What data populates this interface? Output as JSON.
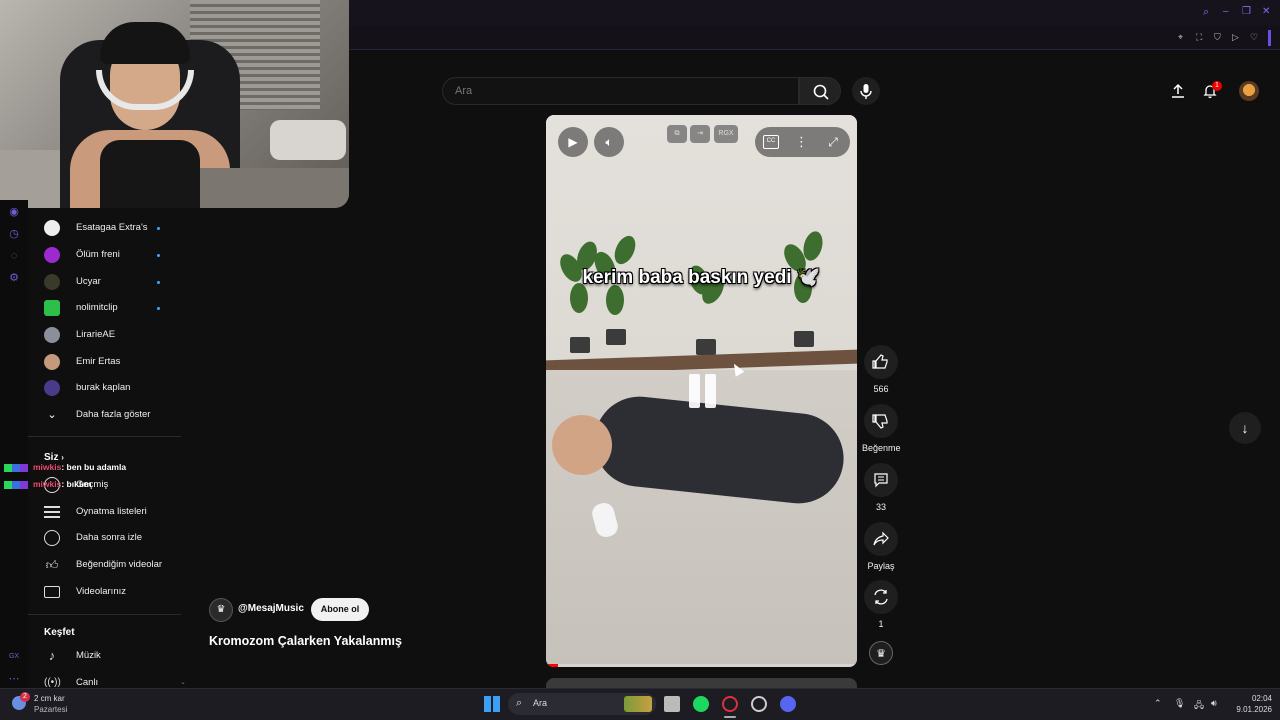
{
  "search": {
    "placeholder": "Ara"
  },
  "header": {
    "notification_count": "1"
  },
  "sidebar": {
    "subscriptions": [
      {
        "label": "Esatagaa Extra's",
        "color": "#eeeeee",
        "dot": true
      },
      {
        "label": "Ölüm freni",
        "color": "#9b2bd0",
        "dot": true
      },
      {
        "label": "Ucyar",
        "color": "#3a3a2a",
        "dot": true
      },
      {
        "label": "nolimitclip",
        "color": "#2dbf4a",
        "dot": true
      },
      {
        "label": "LirarieAE",
        "color": "#8a8f99",
        "dot": false
      },
      {
        "label": "Emir Ertas",
        "color": "#c49a7a",
        "dot": false
      },
      {
        "label": "burak kaplan",
        "color": "#4a3a8a",
        "dot": false
      }
    ],
    "show_more": "Daha fazla göster",
    "you_section": "Siz",
    "you_items": [
      {
        "label": "Geçmiş"
      },
      {
        "label": "Oynatma listeleri"
      },
      {
        "label": "Daha sonra izle"
      },
      {
        "label": "Beğendiğim videolar"
      },
      {
        "label": "Videolarınız"
      }
    ],
    "explore_section": "Keşfet",
    "explore_items": [
      {
        "label": "Müzik"
      },
      {
        "label": "Canlı"
      }
    ]
  },
  "chat": [
    {
      "user": "miwkis",
      "message": ": ben bu adamla"
    },
    {
      "user": "miwkis",
      "message": ": bıktım"
    }
  ],
  "player": {
    "caption": "kerim baba baskın yedi 🕊️",
    "chip_label": "RGX",
    "progress": 0.04
  },
  "actions": {
    "likes": "566",
    "dislike_label": "Beğenme",
    "comments": "33",
    "share_label": "Paylaş",
    "remix_count": "1"
  },
  "channel": {
    "handle": "@MesajMusic",
    "subscribe_label": "Abone ol"
  },
  "video": {
    "title": "Kromozom Çalarken Yakalanmış"
  },
  "taskbar": {
    "weather_temp": "2 cm kar",
    "weather_day": "Pazartesi",
    "weather_badge": "2",
    "search_label": "Ara",
    "time": "02:04",
    "date": "9.01.2026"
  }
}
